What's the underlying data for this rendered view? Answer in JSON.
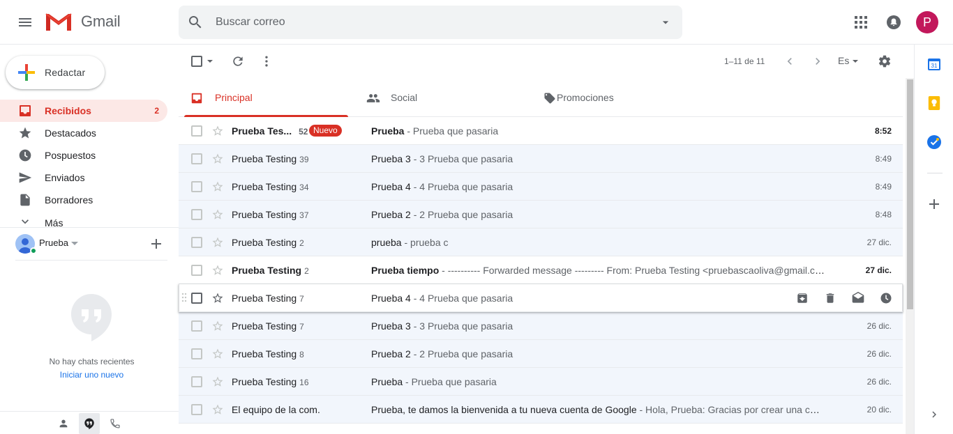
{
  "header": {
    "app_name": "Gmail",
    "search_placeholder": "Buscar correo",
    "avatar_letter": "P",
    "brand_color": "#d93025"
  },
  "sidebar": {
    "compose_label": "Redactar",
    "items": [
      {
        "label": "Recibidos",
        "count": "2",
        "icon": "inbox-icon",
        "active": true
      },
      {
        "label": "Destacados",
        "count": "",
        "icon": "star-icon"
      },
      {
        "label": "Pospuestos",
        "count": "",
        "icon": "clock-icon"
      },
      {
        "label": "Enviados",
        "count": "",
        "icon": "send-icon"
      },
      {
        "label": "Borradores",
        "count": "",
        "icon": "draft-icon"
      },
      {
        "label": "Más",
        "count": "",
        "icon": "chevron-down-icon"
      }
    ]
  },
  "hangouts": {
    "user_name": "Prueba",
    "no_chats_text": "No hay chats recientes",
    "start_new_link": "Iniciar uno nuevo"
  },
  "toolbar": {
    "pagination": "1–11 de 11",
    "language": "Es"
  },
  "tabs": [
    {
      "label": "Principal",
      "icon": "inbox-icon",
      "active": true
    },
    {
      "label": "Social",
      "icon": "people-icon"
    },
    {
      "label": "Promociones",
      "icon": "tag-icon"
    }
  ],
  "emails": [
    {
      "sender": "Prueba Tes...",
      "count": "52",
      "badge": "Nuevo",
      "subject": "Prueba",
      "snippet": " - Prueba que pasaria",
      "date": "8:52",
      "unread": true
    },
    {
      "sender": "Prueba Testing",
      "count": "39",
      "subject": "Prueba 3",
      "snippet": " - 3 Prueba que pasaria",
      "date": "8:49"
    },
    {
      "sender": "Prueba Testing",
      "count": "34",
      "subject": "Prueba 4",
      "snippet": " - 4 Prueba que pasaria",
      "date": "8:49"
    },
    {
      "sender": "Prueba Testing",
      "count": "37",
      "subject": "Prueba 2",
      "snippet": " - 2 Prueba que pasaria",
      "date": "8:48"
    },
    {
      "sender": "Prueba Testing",
      "count": "2",
      "subject": "prueba",
      "snippet": " - prueba c",
      "date": "27 dic."
    },
    {
      "sender": "Prueba Testing",
      "count": "2",
      "subject": "Prueba tiempo",
      "snippet": " - ---------- Forwarded message --------- From: Prueba Testing <pruebascaoliva@gmail.com>",
      "date": "27 dic.",
      "unread": true
    },
    {
      "sender": "Prueba Testing",
      "count": "7",
      "subject": "Prueba 4",
      "snippet": " - 4 Prueba que pasaria",
      "date": "",
      "hover": true
    },
    {
      "sender": "Prueba Testing",
      "count": "7",
      "subject": "Prueba 3",
      "snippet": " - 3 Prueba que pasaria",
      "date": "26 dic."
    },
    {
      "sender": "Prueba Testing",
      "count": "8",
      "subject": "Prueba 2",
      "snippet": " - 2 Prueba que pasaria",
      "date": "26 dic."
    },
    {
      "sender": "Prueba Testing",
      "count": "16",
      "subject": "Prueba",
      "snippet": " - Prueba que pasaria",
      "date": "26 dic."
    },
    {
      "sender": "El equipo de la com.",
      "count": "",
      "subject": "Prueba, te damos la bienvenida a tu nueva cuenta de Google",
      "snippet": " - Hola, Prueba: Gracias por crear una cuenta de Google.",
      "date": "20 dic."
    }
  ]
}
